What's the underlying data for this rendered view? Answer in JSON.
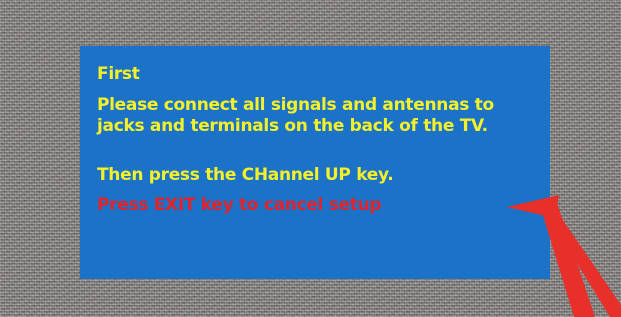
{
  "screen": {
    "background": "static-noise",
    "panel_color": "#1b72c6"
  },
  "dialog": {
    "heading": "First",
    "instruction_line1": "Please connect all signals and antennas to",
    "instruction_line2": "jacks and terminals on the back of the TV.",
    "confirm_prompt": "Then press the CHannel UP key.",
    "cancel_prompt": "Press EXIT key to cancel setup",
    "text_color": "#f4f02a",
    "cancel_color": "#e2232a"
  },
  "annotation": {
    "icon": "arrow-pointer-icon",
    "color": "#e8302a"
  }
}
